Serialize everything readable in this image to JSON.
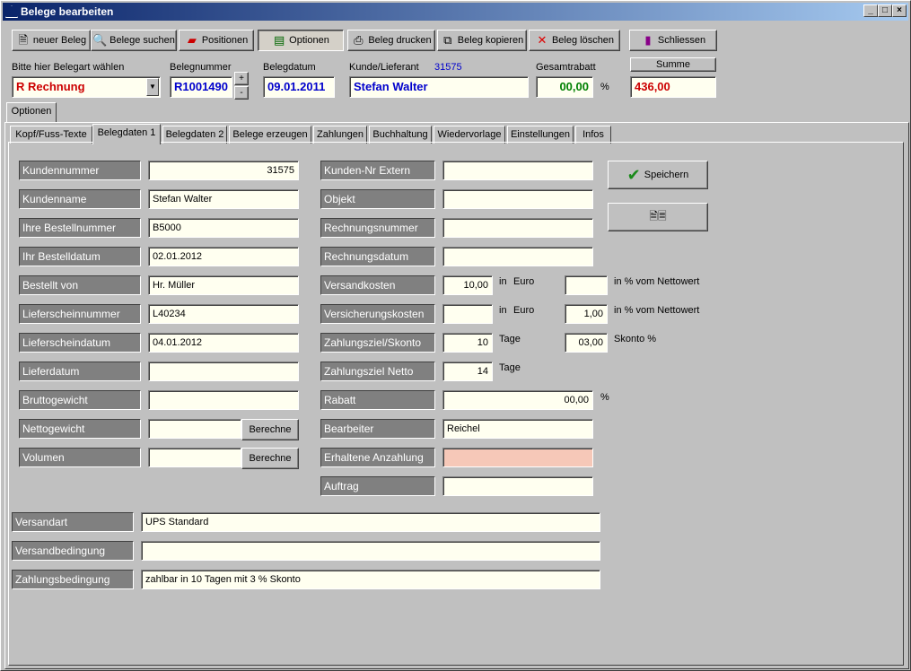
{
  "window": {
    "title": "Belege bearbeiten"
  },
  "toolbar": [
    {
      "key": "new",
      "label": "neuer Beleg",
      "icon": "new-document-icon"
    },
    {
      "key": "search",
      "label": "Belege suchen",
      "icon": "magnifier-icon"
    },
    {
      "key": "positions",
      "label": "Positionen",
      "icon": "eraser-icon"
    },
    {
      "key": "options",
      "label": "Optionen",
      "icon": "options-icon"
    },
    {
      "key": "print",
      "label": "Beleg drucken",
      "icon": "printer-icon"
    },
    {
      "key": "copy",
      "label": "Beleg kopieren",
      "icon": "copy-icon"
    },
    {
      "key": "delete",
      "label": "Beleg löschen",
      "icon": "delete-x-icon"
    },
    {
      "key": "close",
      "label": "Schliessen",
      "icon": "door-exit-icon"
    }
  ],
  "header": {
    "belegart_label": "Bitte hier Belegart wählen",
    "belegart_value": "R  Rechnung",
    "belegnummer_label": "Belegnummer",
    "belegnummer_value": "R1001490",
    "belegdatum_label": "Belegdatum",
    "belegdatum_value": "09.01.2011",
    "kunde_label": "Kunde/Lieferant",
    "kunde_id": "31575",
    "kunde_value": "Stefan Walter",
    "rabatt_label": "Gesamtrabatt",
    "rabatt_value": "00,00",
    "rabatt_unit": "%",
    "summe_label": "Summe",
    "summe_value": "436,00",
    "plus": "+",
    "minus": "-"
  },
  "outer_tab": "Optionen",
  "tabs": [
    "Kopf/Fuss-Texte",
    "Belegdaten 1",
    "Belegdaten 2",
    "Belege erzeugen",
    "Zahlungen",
    "Buchhaltung",
    "Wiedervorlage",
    "Einstellungen",
    "Infos"
  ],
  "active_tab": "Belegdaten 1",
  "left_fields": [
    {
      "label": "Kundennummer",
      "value": "31575"
    },
    {
      "label": "Kundenname",
      "value": "Stefan Walter"
    },
    {
      "label": "Ihre Bestellnummer",
      "value": "B5000"
    },
    {
      "label": "Ihr Bestelldatum",
      "value": "02.01.2012"
    },
    {
      "label": "Bestellt von",
      "value": "Hr. Müller"
    },
    {
      "label": "Lieferscheinnummer",
      "value": "L40234"
    },
    {
      "label": "Lieferscheindatum",
      "value": "04.01.2012"
    },
    {
      "label": "Lieferdatum",
      "value": ""
    },
    {
      "label": "Bruttogewicht",
      "value": ""
    },
    {
      "label": "Nettogewicht",
      "value": ""
    },
    {
      "label": "Volumen",
      "value": ""
    }
  ],
  "berechne_label": "Berechne",
  "right_fields": [
    {
      "label": "Kunden-Nr Extern",
      "value": ""
    },
    {
      "label": "Objekt",
      "value": ""
    },
    {
      "label": "Rechnungsnummer",
      "value": ""
    },
    {
      "label": "Rechnungsdatum",
      "value": ""
    },
    {
      "label": "Versandkosten",
      "value": "10,00"
    },
    {
      "label": "Versicherungskosten",
      "value": ""
    },
    {
      "label": "Zahlungsziel/Skonto",
      "value": "10"
    },
    {
      "label": "Zahlungsziel Netto",
      "value": "14"
    },
    {
      "label": "Rabatt",
      "value": "00,00"
    },
    {
      "label": "Bearbeiter",
      "value": "Reichel"
    },
    {
      "label": "Erhaltene Anzahlung",
      "value": ""
    },
    {
      "label": "Auftrag",
      "value": ""
    }
  ],
  "units": {
    "in": "in",
    "euro": "Euro",
    "tage": "Tage",
    "pct_netto": "in % vom Nettowert",
    "skonto": "Skonto %",
    "pct": "%"
  },
  "extra_values": {
    "versand_pct": "",
    "versicherung_pct": "1,00",
    "skonto_pct": "03,00"
  },
  "bottom_fields": [
    {
      "label": "Versandart",
      "value": "UPS Standard"
    },
    {
      "label": "Versandbedingung",
      "value": ""
    },
    {
      "label": "Zahlungsbedingung",
      "value": "zahlbar in 10 Tagen mit 3 % Skonto"
    }
  ],
  "save_label": "Speichern",
  "colors": {
    "accent_red": "#cc0000",
    "accent_blue": "#0000cc",
    "accent_green": "#008000",
    "anzahlung_bg": "#f6c8b8"
  }
}
